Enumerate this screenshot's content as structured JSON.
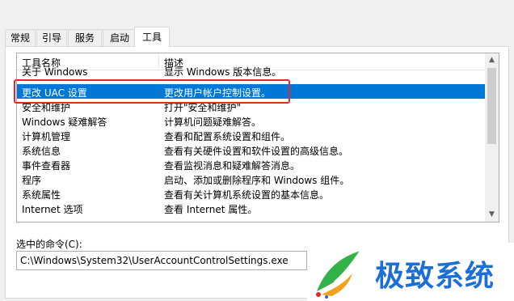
{
  "tabs": [
    {
      "label": "常规"
    },
    {
      "label": "引导"
    },
    {
      "label": "服务"
    },
    {
      "label": "启动"
    },
    {
      "label": "工具"
    }
  ],
  "list": {
    "columns": {
      "name": "工具名称",
      "desc": "描述"
    },
    "rows": [
      {
        "name": "关于 Windows",
        "desc": "显示 Windows 版本信息。"
      },
      {
        "name": "更改 UAC 设置",
        "desc": "更改用户帐户控制设置。"
      },
      {
        "name": "安全和维护",
        "desc": "打开\"安全和维护\""
      },
      {
        "name": "Windows 疑难解答",
        "desc": "计算机问题疑难解答。"
      },
      {
        "name": "计算机管理",
        "desc": "查看和配置系统设置和组件。"
      },
      {
        "name": "系统信息",
        "desc": "查看有关硬件设置和软件设置的高级信息。"
      },
      {
        "name": "事件查看器",
        "desc": "查看监视消息和疑难解答消息。"
      },
      {
        "name": "程序",
        "desc": "启动、添加或删除程序和 Windows 组件。"
      },
      {
        "name": "系统属性",
        "desc": "查看有关计算机系统设置的基本信息。"
      },
      {
        "name": "Internet 选项",
        "desc": "查看 Internet 属性。"
      }
    ],
    "selected_index": 1,
    "selection_color": "#0078d7",
    "highlight_color": "#e02a25"
  },
  "scroll_icons": {
    "up": "chevron-up-icon",
    "down": "chevron-down-icon"
  },
  "command": {
    "label": "选中的命令(C):",
    "value": "C:\\Windows\\System32\\UserAccountControlSettings.exe"
  },
  "watermark": {
    "text": "极致系统",
    "color": "#1d6fd8"
  }
}
